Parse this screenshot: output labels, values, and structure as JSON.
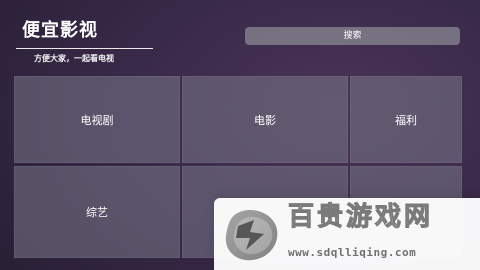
{
  "header": {
    "title": "便宜影视",
    "subtitle": "方便大家，一起看电视"
  },
  "search": {
    "label": "搜索"
  },
  "tiles": [
    {
      "label": "电视剧"
    },
    {
      "label": "电影"
    },
    {
      "label": "福利"
    },
    {
      "label": "综艺"
    },
    {
      "label": ""
    },
    {
      "label": ""
    }
  ],
  "watermark": {
    "brand": "百贵游戏网",
    "url": "www.sdqlliqing.com"
  },
  "icons": {
    "watermark_logo": "brand-logo-icon"
  },
  "colors": {
    "background_dark": "#2a2036",
    "tile": "#787888",
    "search": "#8c8c96",
    "watermark_text": "#707070"
  }
}
